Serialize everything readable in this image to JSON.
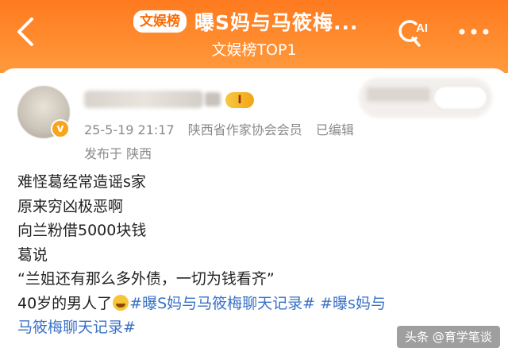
{
  "header": {
    "badge": "文娱榜",
    "title": "曝S妈与马筱梅...",
    "subtitle": "文娱榜TOP1",
    "ai_label": "AI",
    "accent_color": "#ff7a1f",
    "icons": {
      "back": "chevron-left-icon",
      "search_ai": "search-ai-icon",
      "more": "more-dots-icon"
    }
  },
  "post": {
    "level_badge": "I",
    "verify_badge": "v",
    "meta": {
      "time": "25-5-19 21:17",
      "org": "陕西省作家协会会员",
      "edited": "已编辑"
    },
    "posted_from": "发布于 陕西",
    "lines": [
      "难怪葛经常造谣s家",
      "原来穷凶极恶啊",
      "向兰粉借5000块钱",
      "葛说",
      "“兰姐还有那么多外债，一切为钱看齐”"
    ],
    "last_line_prefix": "40岁的男人了",
    "hashtag_1": "#曝S妈与马筱梅聊天记录#",
    "hashtag_2a": "#曝s妈与",
    "hashtag_2b": "马筱梅聊天记录#",
    "hashtag_color": "#3b71c7"
  },
  "watermark": "头条 @育学笔谈"
}
